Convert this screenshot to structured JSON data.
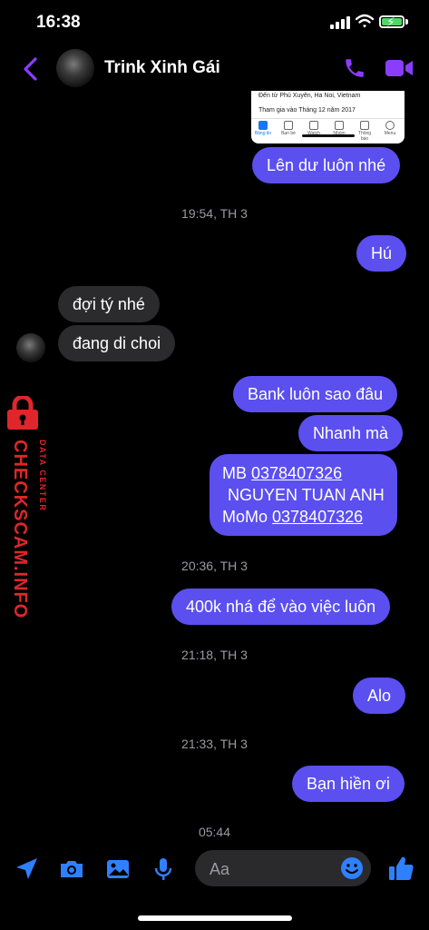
{
  "status": {
    "time": "16:38"
  },
  "header": {
    "contact_name": "Trink Xinh Gái"
  },
  "preview": {
    "location": "Đến từ Phú Xuyên, Ha Noi, Vietnam",
    "joined": "Tham gia vào Tháng 12 năm 2017",
    "tabs": [
      "Bảng tin",
      "Bạn bè",
      "Watch",
      "Nhóm",
      "Thông báo",
      "Menu"
    ]
  },
  "messages": {
    "m1": "Lên dư luôn nhé",
    "t1": "19:54, TH 3",
    "m2": "Hú",
    "m3": "đợi tý nhé",
    "m4": "đang di choi",
    "m5": "Bank luôn sao đâu",
    "m6": "Nhanh mà",
    "m7": {
      "mb_label": "MB ",
      "mb_number": "0378407326",
      "name": "NGUYEN TUAN ANH",
      "momo_label": "MoMo ",
      "momo_number": "0378407326"
    },
    "t2": "20:36, TH 3",
    "m8": "400k nhá để vào việc luôn",
    "t3": "21:18, TH 3",
    "m9": "Alo",
    "t4": "21:33, TH 3",
    "m10": "Bạn hiền ơi",
    "t5": "05:44"
  },
  "watermark": {
    "brand": "CHECKSCAM.INFO",
    "sub": "DATA CENTER"
  },
  "composer": {
    "placeholder": "Aa"
  },
  "colors": {
    "accent": "#5b4ff0",
    "icon_purple": "#8b3dff",
    "icon_blue": "#2f80ff",
    "watermark_red": "#e0262a"
  }
}
